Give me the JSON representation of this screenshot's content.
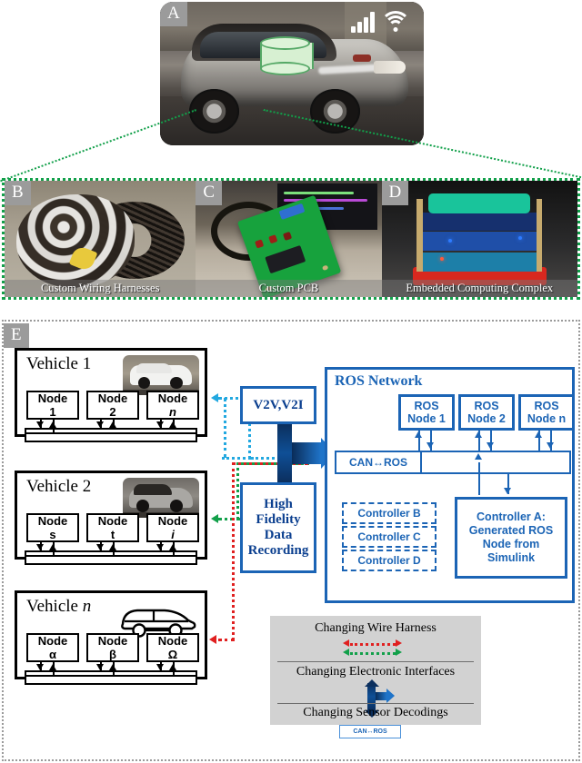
{
  "figure": {
    "panels": {
      "a": {
        "label": "A",
        "description": "Instrumented test vehicle with data-logging cylinder overlay, cellular signal icon and wifi icon"
      },
      "b": {
        "label": "B",
        "caption": "Custom Wiring Harnesses"
      },
      "c": {
        "label": "C",
        "caption": "Custom PCB"
      },
      "d": {
        "label": "D",
        "caption": "Embedded Computing Complex"
      },
      "e": {
        "label": "E"
      }
    }
  },
  "panelA": {
    "icons": {
      "signal": "signal-bars-icon",
      "wifi": "wifi-icon",
      "storage": "data-cylinder-icon"
    }
  },
  "diagram": {
    "vehicles": [
      {
        "title": "Vehicle 1",
        "title_italic": "",
        "nodes": [
          {
            "top": "Node",
            "bottom": "1",
            "italic": false
          },
          {
            "top": "Node",
            "bottom": "2",
            "italic": false
          },
          {
            "top": "Node",
            "bottom": "n",
            "italic": true
          }
        ]
      },
      {
        "title": "Vehicle 2",
        "title_italic": "",
        "nodes": [
          {
            "top": "Node",
            "bottom": "s",
            "italic": false
          },
          {
            "top": "Node",
            "bottom": "t",
            "italic": false
          },
          {
            "top": "Node",
            "bottom": "i",
            "italic": true
          }
        ]
      },
      {
        "title": "Vehicle",
        "title_italic": "n",
        "nodes": [
          {
            "top": "Node",
            "bottom": "α",
            "italic": false
          },
          {
            "top": "Node",
            "bottom": "β",
            "italic": false
          },
          {
            "top": "Node",
            "bottom": "Ω",
            "italic": false
          }
        ]
      }
    ],
    "middle": {
      "v2x_label": "V2V,V2I",
      "recording_label": [
        "High",
        "Fidelity",
        "Data",
        "Recording"
      ]
    },
    "ros": {
      "title": "ROS Network",
      "nodes": [
        {
          "line1": "ROS",
          "line2": "Node 1",
          "italic": false
        },
        {
          "line1": "ROS",
          "line2": "Node 2",
          "italic": false
        },
        {
          "line1": "ROS",
          "line2": "Node n",
          "italic": true
        }
      ],
      "bridge_label": "CAN↔ROS",
      "controllers_dashed": [
        "Controller B",
        "Controller C",
        "Controller D"
      ],
      "controller_a": [
        "Controller A:",
        "Generated ROS",
        "Node from",
        "Simulink"
      ]
    },
    "legend": {
      "rows": [
        {
          "text": "Changing Wire Harness",
          "marker": "double-dotted-arrows"
        },
        {
          "text": "Changing Electronic Interfaces",
          "marker": "thick-blue-arrow"
        },
        {
          "text": "Changing Sensor Decodings",
          "marker": "can-ros-badge"
        }
      ],
      "badge_label": "CAN↔ROS"
    }
  },
  "colors": {
    "accent_blue": "#1b64b5",
    "dark_arrow": "#0f4f96",
    "route_cyan": "#22a8e0",
    "route_green": "#12a04a",
    "route_red": "#e02020",
    "legend_bg": "#d2d2d2",
    "panel_label_bg": "#9b9b9b"
  }
}
